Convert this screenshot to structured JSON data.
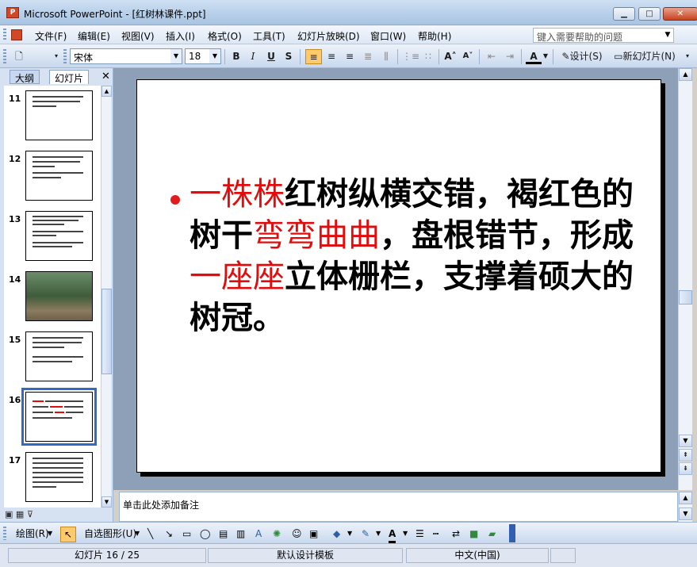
{
  "window": {
    "title": "Microsoft PowerPoint - [红树林课件.ppt]",
    "min_label": "▁",
    "max_label": "□",
    "close_label": "✕"
  },
  "menu": {
    "items": [
      "文件(F)",
      "编辑(E)",
      "视图(V)",
      "插入(I)",
      "格式(O)",
      "工具(T)",
      "幻灯片放映(D)",
      "窗口(W)",
      "帮助(H)"
    ],
    "help_placeholder": "键入需要帮助的问题"
  },
  "toolbar": {
    "font": "宋体",
    "size": "18",
    "bold": "B",
    "italic": "I",
    "underline": "U",
    "shadow": "S",
    "design": "设计(S)",
    "new_slide": "新幻灯片(N)"
  },
  "left_panel": {
    "tab_outline": "大纲",
    "tab_slides": "幻灯片",
    "close": "✕",
    "slide_numbers": [
      "11",
      "12",
      "13",
      "14",
      "15",
      "16",
      "17"
    ],
    "selected_slide": "16"
  },
  "slide": {
    "text_parts": [
      {
        "text": "一株株",
        "color": "red"
      },
      {
        "text": "红树纵横交错，褐红色的树干",
        "color": "black"
      },
      {
        "text": "弯弯曲曲",
        "color": "red"
      },
      {
        "text": "，盘根错节，形成",
        "color": "black"
      },
      {
        "text": "一座座",
        "color": "red"
      },
      {
        "text": "立体栅栏，支撑着硕大的树冠。",
        "color": "black"
      }
    ]
  },
  "notes": {
    "placeholder": "单击此处添加备注"
  },
  "drawbar": {
    "draw": "绘图(R)",
    "autoshapes": "自选图形(U)"
  },
  "status": {
    "slide_pos": "幻灯片 16 / 25",
    "template": "默认设计模板",
    "language": "中文(中国)"
  },
  "colors": {
    "accent_red": "#e30b0b",
    "selection_blue": "#316ac5"
  }
}
